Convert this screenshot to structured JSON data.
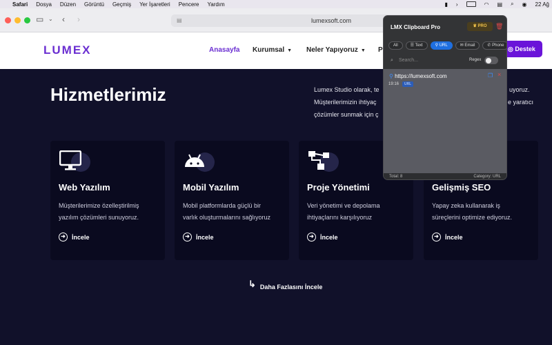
{
  "menubar": {
    "items": [
      "Safari",
      "Dosya",
      "Düzen",
      "Görüntü",
      "Geçmiş",
      "Yer İşaretleri",
      "Pencere",
      "Yardım"
    ],
    "date": "22 Ağ"
  },
  "browser": {
    "url": "lumexsoft.com"
  },
  "site": {
    "logo": "LUMEX",
    "nav": {
      "home": "Anasayfa",
      "corporate": "Kurumsal",
      "what_we_do": "Neler Yapıyoruz",
      "partial": "P",
      "support": "Destek"
    },
    "heading": "Hizmetlerimiz",
    "intro_lines": [
      "Lumex Studio olarak, te",
      "Müşterilerimizin ihtiyaç",
      "çözümler sunmak için ç"
    ],
    "intro_tail": [
      "uyoruz.",
      "e yaratıcı"
    ],
    "cards": [
      {
        "title": "Web Yazılım",
        "desc1": "Müşterilerimize özelleştirilmiş",
        "desc2": "yazılım çözümleri sunuyoruz.",
        "more": "İncele"
      },
      {
        "title": "Mobil Yazılım",
        "desc1": "Mobil platformlarda güçlü bir",
        "desc2": "varlık oluşturmalarını sağlıyoruz",
        "more": "İncele"
      },
      {
        "title": "Proje Yönetimi",
        "desc1": "Veri yönetimi ve depolama",
        "desc2": "ihtiyaçlarını karşılıyoruz",
        "more": "İncele"
      },
      {
        "title": "Gelişmiş SEO",
        "desc1": "Yapay zeka kullanarak iş",
        "desc2": "süreçlerini optimize ediyoruz.",
        "more": "İncele"
      }
    ],
    "more_link": "Daha Fazlasını İncele"
  },
  "clipboard": {
    "title": "LMX Clipboard Pro",
    "badge": "PRO",
    "tabs": [
      "All",
      "Text",
      "URL",
      "Email",
      "Phone"
    ],
    "active_tab": "URL",
    "search_placeholder": "Search...",
    "regex_label": "Regex",
    "regex_enabled": false,
    "items": [
      {
        "text": "https://lumexsoft.com",
        "time": "19:16",
        "type": "URL"
      }
    ],
    "footer_total": "Total: 8",
    "footer_category": "Category: URL"
  },
  "colors": {
    "brand": "#6a2ed1",
    "support_button": "#6a14d9",
    "background": "#11112a",
    "card": "#0a0a1f",
    "active_tab": "#1f6fe0"
  }
}
